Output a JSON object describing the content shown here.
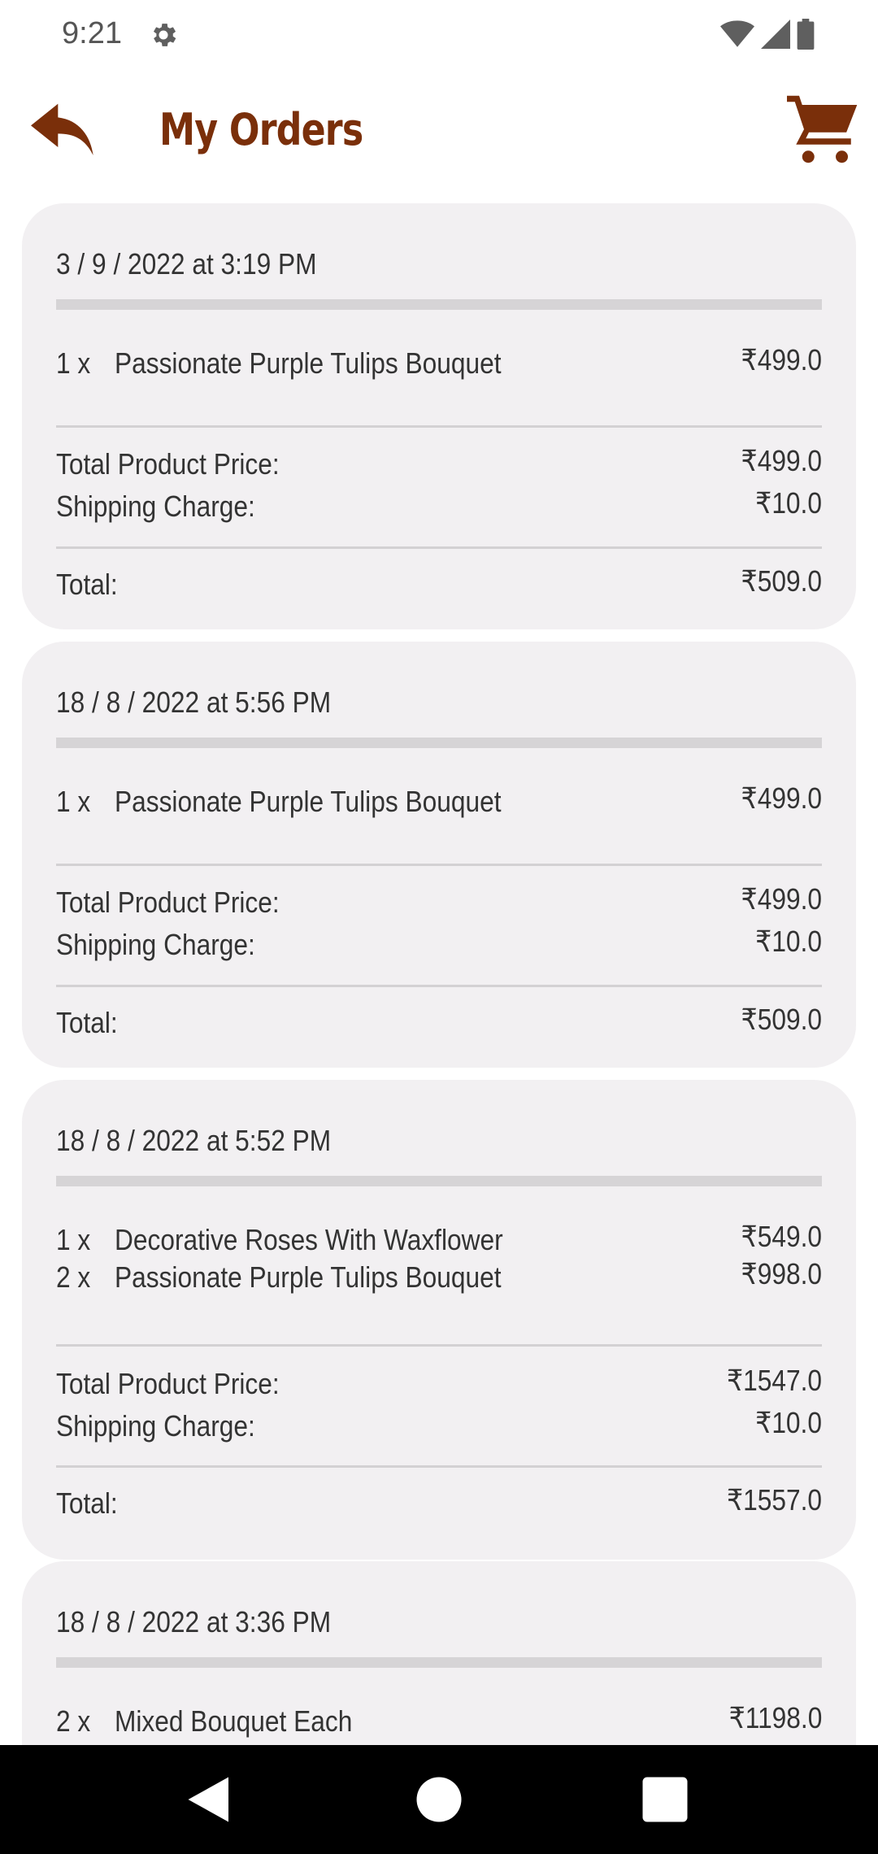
{
  "status_bar": {
    "time": "9:21",
    "icons": [
      "gear-icon",
      "wifi-icon",
      "signal-icon",
      "battery-icon"
    ]
  },
  "app_bar": {
    "title": "My Orders",
    "back_icon": "back-arrow-icon",
    "cart_icon": "cart-icon"
  },
  "colors": {
    "brand": "#7a2f0a",
    "card_bg": "#f2f0f2",
    "rule": "#d6d4d6"
  },
  "orders": [
    {
      "date": "3 / 9 / 2022 at 3:19 PM",
      "items": [
        {
          "qty": "1 x",
          "name": "Passionate Purple Tulips Bouquet",
          "price": "₹499.0"
        }
      ],
      "total_product_label": "Total Product Price:",
      "total_product_price": "₹499.0",
      "shipping_label": "Shipping Charge:",
      "shipping_charge": "₹10.0",
      "total_label": "Total:",
      "total": "₹509.0"
    },
    {
      "date": "18 / 8 / 2022 at 5:56 PM",
      "items": [
        {
          "qty": "1 x",
          "name": "Passionate Purple Tulips Bouquet",
          "price": "₹499.0"
        }
      ],
      "total_product_label": "Total Product Price:",
      "total_product_price": "₹499.0",
      "shipping_label": "Shipping Charge:",
      "shipping_charge": "₹10.0",
      "total_label": "Total:",
      "total": "₹509.0"
    },
    {
      "date": "18 / 8 / 2022 at 5:52 PM",
      "items": [
        {
          "qty": "1 x",
          "name": "Decorative Roses With Waxflower",
          "price": "₹549.0"
        },
        {
          "qty": "2 x",
          "name": "Passionate Purple Tulips Bouquet",
          "price": "₹998.0"
        }
      ],
      "total_product_label": "Total Product Price:",
      "total_product_price": "₹1547.0",
      "shipping_label": "Shipping Charge:",
      "shipping_charge": "₹10.0",
      "total_label": "Total:",
      "total": "₹1557.0"
    },
    {
      "date": "18 / 8 / 2022 at 3:36 PM",
      "items": [
        {
          "qty": "2 x",
          "name": "Mixed Bouquet Each",
          "price": "₹1198.0"
        }
      ]
    }
  ],
  "nav_bar": {
    "icons": [
      "nav-back-icon",
      "nav-home-icon",
      "nav-recents-icon"
    ]
  }
}
